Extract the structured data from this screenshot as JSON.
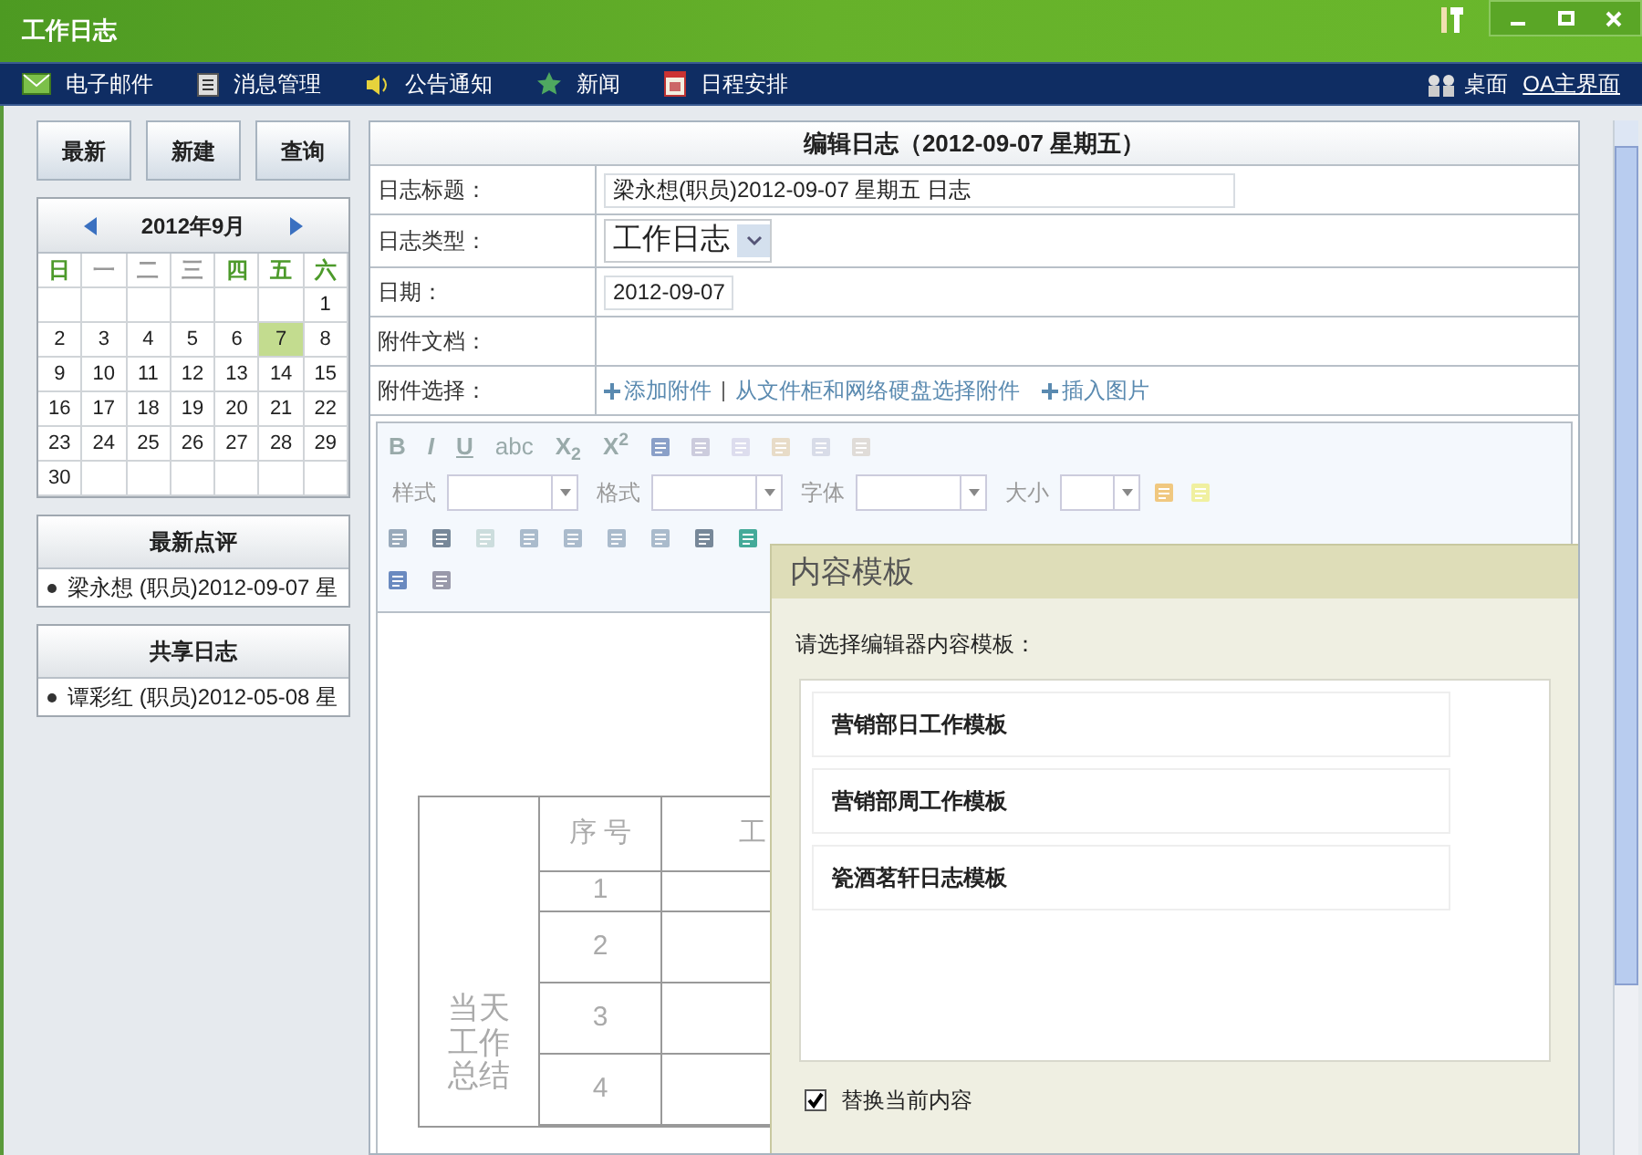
{
  "window": {
    "title": "工作日志"
  },
  "nav": {
    "items": [
      {
        "label": "电子邮件",
        "kind": "mail"
      },
      {
        "label": "消息管理",
        "kind": "list"
      },
      {
        "label": "公告通知",
        "kind": "speaker"
      },
      {
        "label": "新闻",
        "kind": "star"
      },
      {
        "label": "日程安排",
        "kind": "calendar"
      }
    ],
    "desktop": "桌面",
    "home_link": "OA主界面"
  },
  "sidebar": {
    "buttons": [
      "最新",
      "新建",
      "查询"
    ],
    "calendar": {
      "month": "2012年9月",
      "weekdays": [
        {
          "label": "日",
          "highlight": true
        },
        {
          "label": "一",
          "highlight": false
        },
        {
          "label": "二",
          "highlight": false
        },
        {
          "label": "三",
          "highlight": false
        },
        {
          "label": "四",
          "highlight": true
        },
        {
          "label": "五",
          "highlight": true
        },
        {
          "label": "六",
          "highlight": true
        }
      ],
      "weeks": [
        [
          {
            "day": "1",
            "selected": false
          }
        ],
        [
          {
            "day": "2",
            "selected": false
          },
          {
            "day": "3",
            "selected": false
          },
          {
            "day": "4",
            "selected": false
          },
          {
            "day": "5",
            "selected": false
          },
          {
            "day": "6",
            "selected": false
          },
          {
            "day": "7",
            "selected": true
          },
          {
            "day": "8",
            "selected": false
          }
        ],
        [
          {
            "day": "9",
            "selected": false
          },
          {
            "day": "10",
            "selected": false
          },
          {
            "day": "11",
            "selected": false
          },
          {
            "day": "12",
            "selected": false
          },
          {
            "day": "13",
            "selected": false
          },
          {
            "day": "14",
            "selected": false
          },
          {
            "day": "15",
            "selected": false
          }
        ],
        [
          {
            "day": "16",
            "selected": false
          },
          {
            "day": "17",
            "selected": false
          },
          {
            "day": "18",
            "selected": false
          },
          {
            "day": "19",
            "selected": false
          },
          {
            "day": "20",
            "selected": false
          },
          {
            "day": "21",
            "selected": false
          },
          {
            "day": "22",
            "selected": false
          }
        ],
        [
          {
            "day": "23",
            "selected": false
          },
          {
            "day": "24",
            "selected": false
          },
          {
            "day": "25",
            "selected": false
          },
          {
            "day": "26",
            "selected": false
          },
          {
            "day": "27",
            "selected": false
          },
          {
            "day": "28",
            "selected": false
          },
          {
            "day": "29",
            "selected": false
          }
        ],
        [
          {
            "day": "30",
            "selected": false
          }
        ]
      ]
    },
    "sections": [
      {
        "title": "最新点评",
        "items": [
          "梁永想 (职员)2012-09-07 星"
        ]
      },
      {
        "title": "共享日志",
        "items": [
          "谭彩红 (职员)2012-05-08 星"
        ]
      }
    ]
  },
  "form": {
    "heading": "编辑日志（2012-09-07 星期五）",
    "rows": [
      {
        "label": "日志标题：",
        "kind": "text",
        "value": "梁永想(职员)2012-09-07 星期五 日志"
      },
      {
        "label": "日志类型：",
        "kind": "select",
        "value": "工作日志"
      },
      {
        "label": "日期：",
        "kind": "date",
        "value": "2012-09-07"
      },
      {
        "label": "附件文档：",
        "kind": "empty"
      },
      {
        "label": "附件选择：",
        "kind": "links",
        "links": [
          "添加附件",
          "从文件柜和网络硬盘选择附件",
          "插入图片"
        ]
      }
    ]
  },
  "editor": {
    "format_buttons": [
      "B",
      "I",
      "U",
      "abc",
      "X$_{2}$",
      "X$^{2}$"
    ],
    "dropdowns": [
      "样式",
      "格式",
      "字体",
      "大小"
    ],
    "table": {
      "side_label": "当天工作总结",
      "columns": [
        "序 号",
        "工"
      ],
      "rows": [
        "1",
        "2",
        "3",
        "4"
      ]
    }
  },
  "dialog": {
    "title": "内容模板",
    "prompt": "请选择编辑器内容模板：",
    "templates": [
      "营销部日工作模板",
      "营销部周工作模板",
      "瓷酒茗轩日志模板"
    ],
    "replace": {
      "label": "替换当前内容",
      "checked": true
    }
  }
}
